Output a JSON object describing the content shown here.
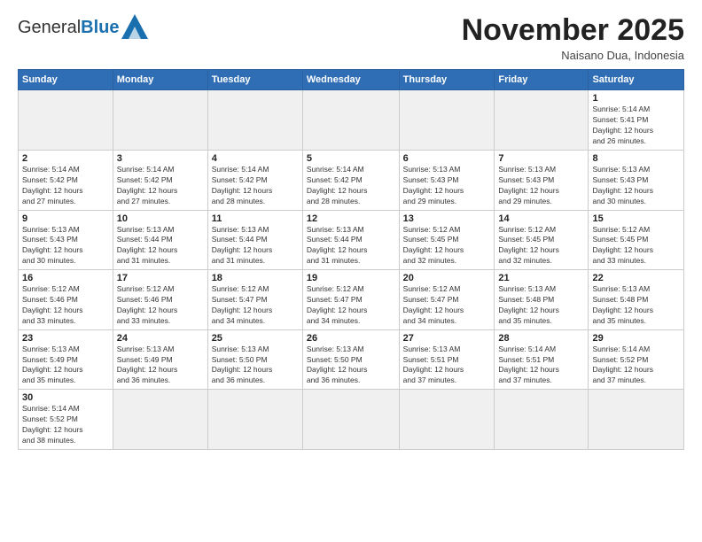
{
  "header": {
    "logo_general": "General",
    "logo_blue": "Blue",
    "month_title": "November 2025",
    "subtitle": "Naisano Dua, Indonesia"
  },
  "weekdays": [
    "Sunday",
    "Monday",
    "Tuesday",
    "Wednesday",
    "Thursday",
    "Friday",
    "Saturday"
  ],
  "weeks": [
    [
      {
        "day": "",
        "info": ""
      },
      {
        "day": "",
        "info": ""
      },
      {
        "day": "",
        "info": ""
      },
      {
        "day": "",
        "info": ""
      },
      {
        "day": "",
        "info": ""
      },
      {
        "day": "",
        "info": ""
      },
      {
        "day": "1",
        "info": "Sunrise: 5:14 AM\nSunset: 5:41 PM\nDaylight: 12 hours\nand 26 minutes."
      }
    ],
    [
      {
        "day": "2",
        "info": "Sunrise: 5:14 AM\nSunset: 5:42 PM\nDaylight: 12 hours\nand 27 minutes."
      },
      {
        "day": "3",
        "info": "Sunrise: 5:14 AM\nSunset: 5:42 PM\nDaylight: 12 hours\nand 27 minutes."
      },
      {
        "day": "4",
        "info": "Sunrise: 5:14 AM\nSunset: 5:42 PM\nDaylight: 12 hours\nand 28 minutes."
      },
      {
        "day": "5",
        "info": "Sunrise: 5:14 AM\nSunset: 5:42 PM\nDaylight: 12 hours\nand 28 minutes."
      },
      {
        "day": "6",
        "info": "Sunrise: 5:13 AM\nSunset: 5:43 PM\nDaylight: 12 hours\nand 29 minutes."
      },
      {
        "day": "7",
        "info": "Sunrise: 5:13 AM\nSunset: 5:43 PM\nDaylight: 12 hours\nand 29 minutes."
      },
      {
        "day": "8",
        "info": "Sunrise: 5:13 AM\nSunset: 5:43 PM\nDaylight: 12 hours\nand 30 minutes."
      }
    ],
    [
      {
        "day": "9",
        "info": "Sunrise: 5:13 AM\nSunset: 5:43 PM\nDaylight: 12 hours\nand 30 minutes."
      },
      {
        "day": "10",
        "info": "Sunrise: 5:13 AM\nSunset: 5:44 PM\nDaylight: 12 hours\nand 31 minutes."
      },
      {
        "day": "11",
        "info": "Sunrise: 5:13 AM\nSunset: 5:44 PM\nDaylight: 12 hours\nand 31 minutes."
      },
      {
        "day": "12",
        "info": "Sunrise: 5:13 AM\nSunset: 5:44 PM\nDaylight: 12 hours\nand 31 minutes."
      },
      {
        "day": "13",
        "info": "Sunrise: 5:12 AM\nSunset: 5:45 PM\nDaylight: 12 hours\nand 32 minutes."
      },
      {
        "day": "14",
        "info": "Sunrise: 5:12 AM\nSunset: 5:45 PM\nDaylight: 12 hours\nand 32 minutes."
      },
      {
        "day": "15",
        "info": "Sunrise: 5:12 AM\nSunset: 5:45 PM\nDaylight: 12 hours\nand 33 minutes."
      }
    ],
    [
      {
        "day": "16",
        "info": "Sunrise: 5:12 AM\nSunset: 5:46 PM\nDaylight: 12 hours\nand 33 minutes."
      },
      {
        "day": "17",
        "info": "Sunrise: 5:12 AM\nSunset: 5:46 PM\nDaylight: 12 hours\nand 33 minutes."
      },
      {
        "day": "18",
        "info": "Sunrise: 5:12 AM\nSunset: 5:47 PM\nDaylight: 12 hours\nand 34 minutes."
      },
      {
        "day": "19",
        "info": "Sunrise: 5:12 AM\nSunset: 5:47 PM\nDaylight: 12 hours\nand 34 minutes."
      },
      {
        "day": "20",
        "info": "Sunrise: 5:12 AM\nSunset: 5:47 PM\nDaylight: 12 hours\nand 34 minutes."
      },
      {
        "day": "21",
        "info": "Sunrise: 5:13 AM\nSunset: 5:48 PM\nDaylight: 12 hours\nand 35 minutes."
      },
      {
        "day": "22",
        "info": "Sunrise: 5:13 AM\nSunset: 5:48 PM\nDaylight: 12 hours\nand 35 minutes."
      }
    ],
    [
      {
        "day": "23",
        "info": "Sunrise: 5:13 AM\nSunset: 5:49 PM\nDaylight: 12 hours\nand 35 minutes."
      },
      {
        "day": "24",
        "info": "Sunrise: 5:13 AM\nSunset: 5:49 PM\nDaylight: 12 hours\nand 36 minutes."
      },
      {
        "day": "25",
        "info": "Sunrise: 5:13 AM\nSunset: 5:50 PM\nDaylight: 12 hours\nand 36 minutes."
      },
      {
        "day": "26",
        "info": "Sunrise: 5:13 AM\nSunset: 5:50 PM\nDaylight: 12 hours\nand 36 minutes."
      },
      {
        "day": "27",
        "info": "Sunrise: 5:13 AM\nSunset: 5:51 PM\nDaylight: 12 hours\nand 37 minutes."
      },
      {
        "day": "28",
        "info": "Sunrise: 5:14 AM\nSunset: 5:51 PM\nDaylight: 12 hours\nand 37 minutes."
      },
      {
        "day": "29",
        "info": "Sunrise: 5:14 AM\nSunset: 5:52 PM\nDaylight: 12 hours\nand 37 minutes."
      }
    ],
    [
      {
        "day": "30",
        "info": "Sunrise: 5:14 AM\nSunset: 5:52 PM\nDaylight: 12 hours\nand 38 minutes."
      },
      {
        "day": "",
        "info": ""
      },
      {
        "day": "",
        "info": ""
      },
      {
        "day": "",
        "info": ""
      },
      {
        "day": "",
        "info": ""
      },
      {
        "day": "",
        "info": ""
      },
      {
        "day": "",
        "info": ""
      }
    ]
  ]
}
